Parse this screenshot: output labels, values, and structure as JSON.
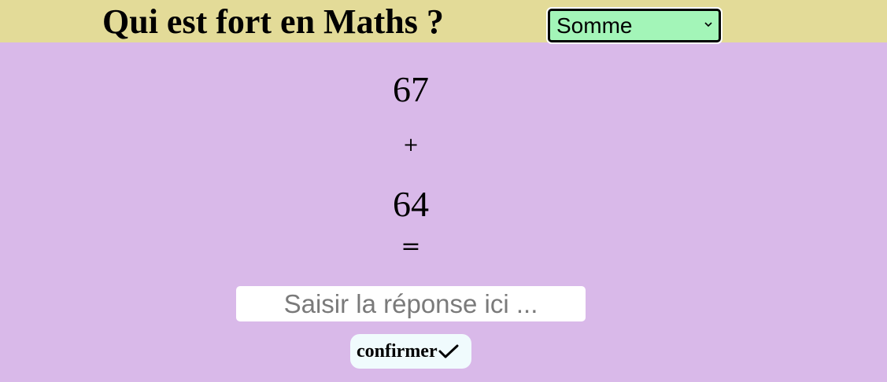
{
  "header": {
    "title": "Qui est fort en Maths ?",
    "operation_select": {
      "selected": "Somme"
    }
  },
  "exercise": {
    "operand_a": "67",
    "operator": "+",
    "operand_b": "64",
    "equals": "="
  },
  "answer": {
    "placeholder": "Saisir la réponse ici ...",
    "value": ""
  },
  "confirm": {
    "label": "confirmer",
    "icon": "check-icon"
  },
  "colors": {
    "header_bg": "#e3db98",
    "page_bg": "#d9b9e9",
    "select_bg": "#a3f5b8",
    "button_bg": "#f0fbfd"
  }
}
